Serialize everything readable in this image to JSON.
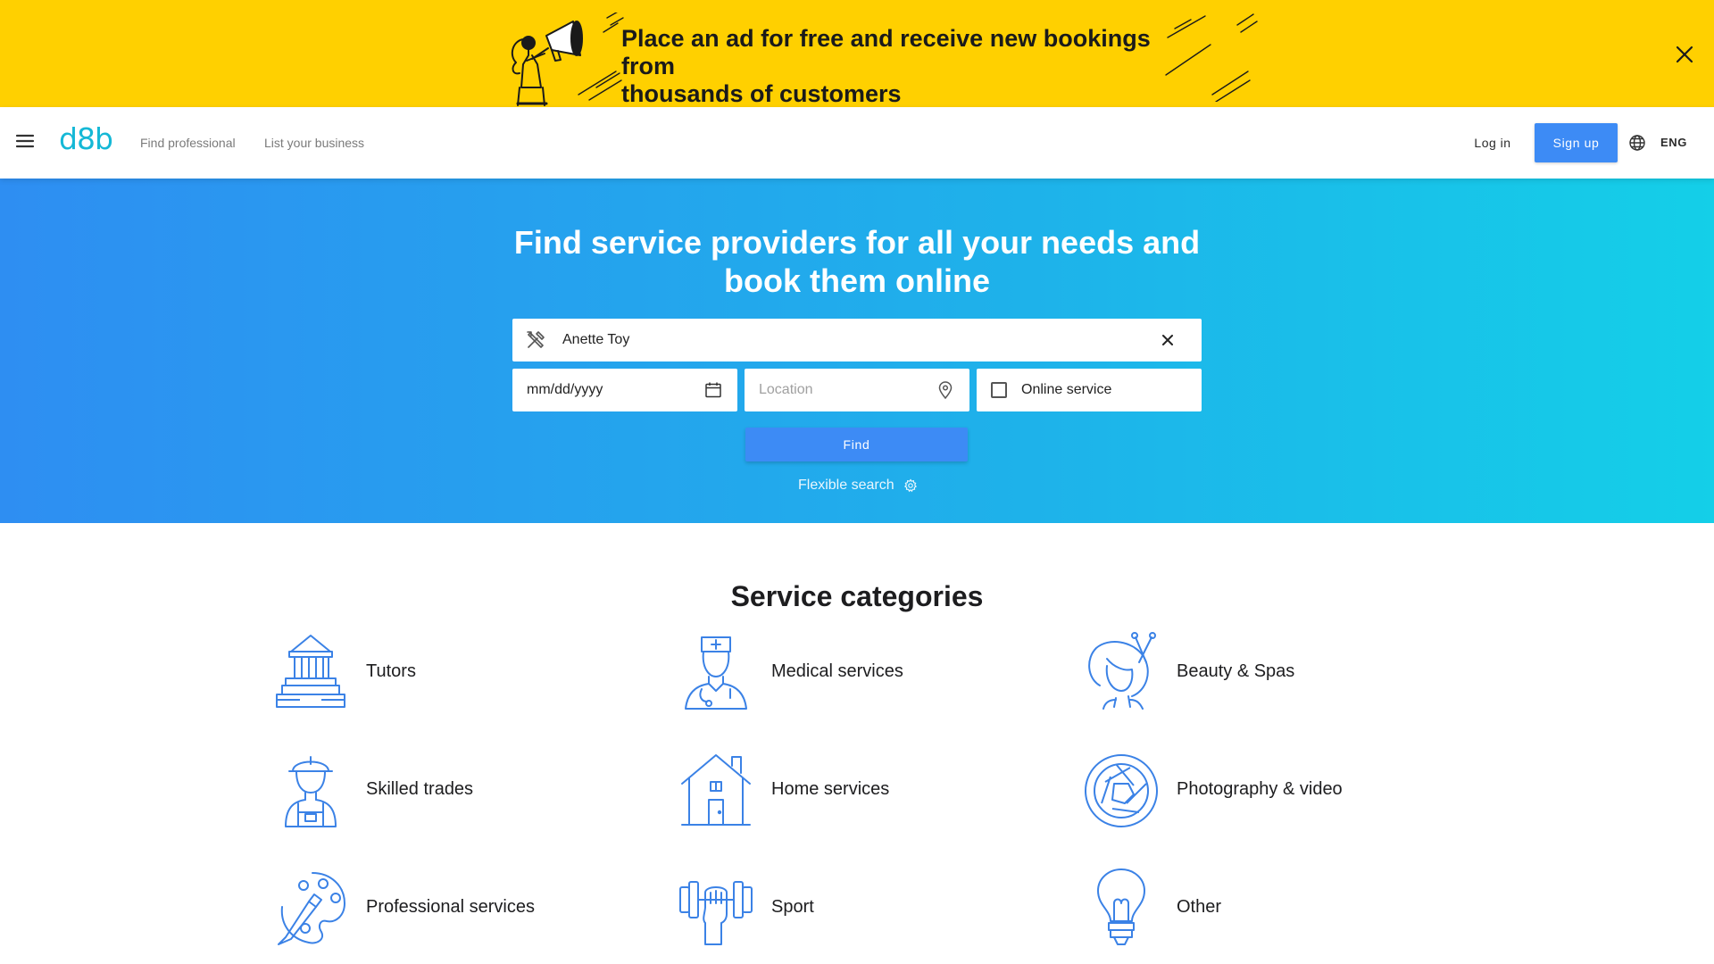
{
  "promo": {
    "line1": "Place an ad for free and receive new bookings from",
    "line2": "thousands of customers"
  },
  "header": {
    "logo": "d8b",
    "nav": {
      "find": "Find professional",
      "list": "List your business"
    },
    "login": "Log in",
    "signup": "Sign up",
    "language": "ENG"
  },
  "hero": {
    "title_line1": "Find service providers for all your needs and",
    "title_line2": "book them online",
    "search_value": "Anette Toy",
    "date_placeholder": "mm/dd/yyyy",
    "location_placeholder": "Location",
    "online_label": "Online service",
    "online_checked": false,
    "find_label": "Find",
    "flexible_label": "Flexible search"
  },
  "categories": {
    "title": "Service categories",
    "items": [
      {
        "label": "Tutors",
        "icon": "library-icon"
      },
      {
        "label": "Medical services",
        "icon": "nurse-icon"
      },
      {
        "label": "Beauty & Spas",
        "icon": "hairstyle-icon"
      },
      {
        "label": "Skilled trades",
        "icon": "worker-icon"
      },
      {
        "label": "Home services",
        "icon": "house-icon"
      },
      {
        "label": "Photography & video",
        "icon": "aperture-icon"
      },
      {
        "label": "Professional services",
        "icon": "palette-icon"
      },
      {
        "label": "Sport",
        "icon": "dumbbell-icon"
      },
      {
        "label": "Other",
        "icon": "lightbulb-icon"
      }
    ]
  },
  "colors": {
    "banner": "#ffd000",
    "brand": "#15b8d6",
    "primary_button": "#3d8bf5",
    "icon_blue": "#3b82e6"
  }
}
